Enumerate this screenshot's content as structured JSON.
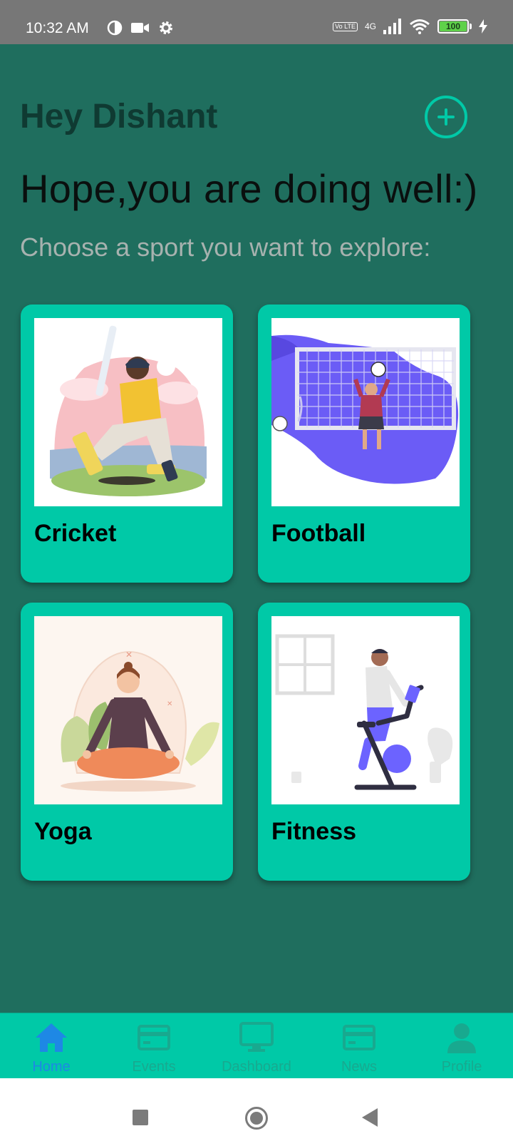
{
  "status_bar": {
    "time": "10:32 AM",
    "network": "4G",
    "volte": "Vo LTE",
    "battery": "100"
  },
  "header": {
    "greeting": "Hey Dishant",
    "subtitle": "Hope,you are doing well:)",
    "prompt": "Choose a sport you want to explore:"
  },
  "sports": [
    {
      "label": "Cricket",
      "icon": "cricket-illustration"
    },
    {
      "label": "Football",
      "icon": "football-illustration"
    },
    {
      "label": "Yoga",
      "icon": "yoga-illustration"
    },
    {
      "label": "Fitness",
      "icon": "fitness-illustration"
    }
  ],
  "bottom_nav": {
    "items": [
      {
        "label": "Home",
        "icon": "home-icon",
        "active": true
      },
      {
        "label": "Events",
        "icon": "card-icon",
        "active": false
      },
      {
        "label": "Dashboard",
        "icon": "monitor-icon",
        "active": false
      },
      {
        "label": "News",
        "icon": "card-icon",
        "active": false
      },
      {
        "label": "Profile",
        "icon": "person-icon",
        "active": false
      }
    ]
  },
  "colors": {
    "background": "#1f6e5e",
    "accent": "#00c9a7",
    "active_nav": "#1e88e5",
    "status_bar": "#777777"
  }
}
